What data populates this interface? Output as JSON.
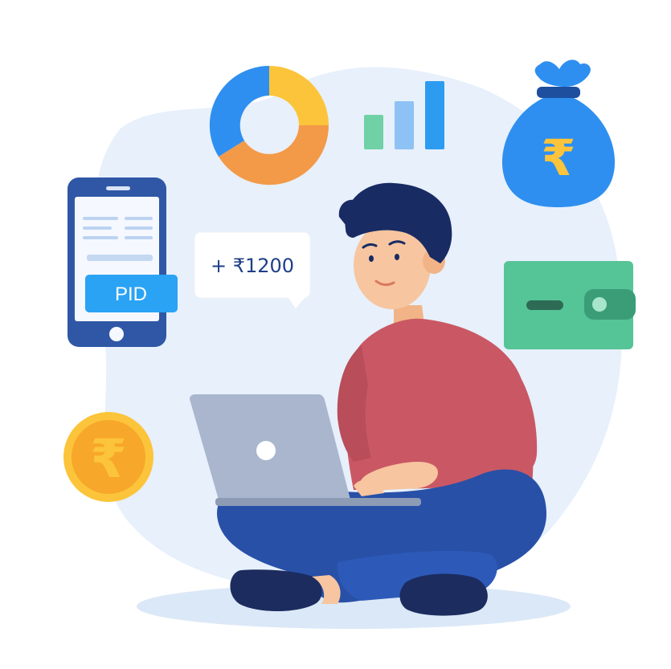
{
  "phone": {
    "button_label": "PID"
  },
  "payment_bubble": {
    "text": "+ ₹1200"
  },
  "icons": {
    "money_bag": "rupee-money-bag-icon",
    "coin": "rupee-coin-icon",
    "wallet": "wallet-icon",
    "donut": "donut-chart-icon",
    "bars": "bar-chart-icon",
    "laptop": "laptop-icon"
  },
  "colors": {
    "blob": "#e7f0fb",
    "phone_frame": "#2f57a5",
    "button_blue": "#2aa3f4",
    "donut_blue": "#2f8ff0",
    "donut_yellow": "#fcc43a",
    "donut_orange": "#f39a48",
    "bar_green": "#6fd1a5",
    "bar_light_blue": "#8fc2f4",
    "bar_blue": "#2d9cf0",
    "bag_blue": "#2e8ff0",
    "rupee_yellow": "#fcc43a",
    "wallet_green": "#55c497",
    "coin_orange": "#f7a72a",
    "shirt": "#c95864",
    "pants": "#2850a7",
    "hair": "#182b63",
    "skin": "#f7c59f"
  }
}
